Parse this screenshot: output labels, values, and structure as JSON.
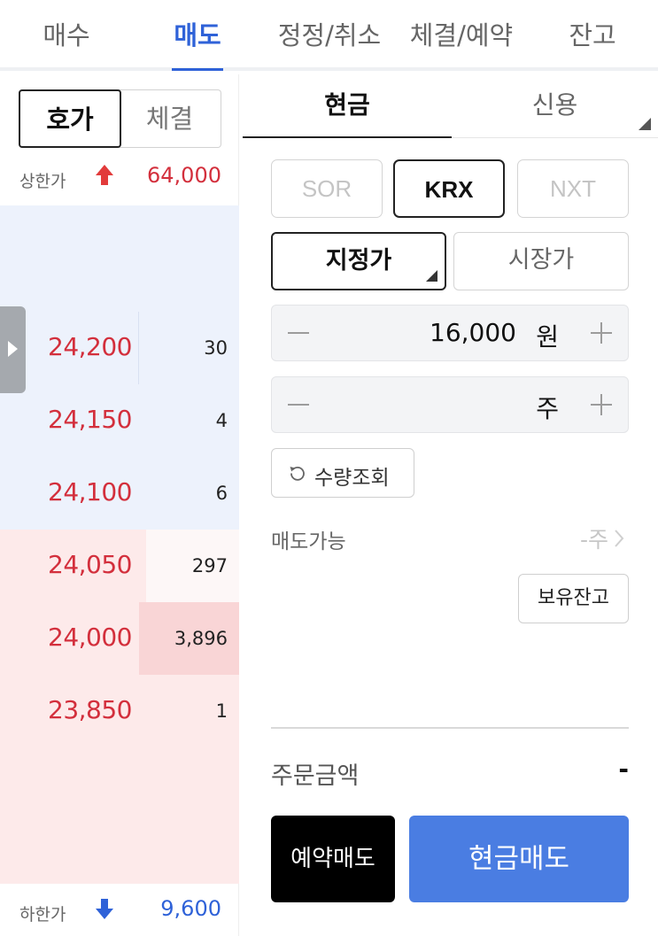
{
  "top_tabs": [
    {
      "label": "매수"
    },
    {
      "label": "매도"
    },
    {
      "label": "정정/취소"
    },
    {
      "label": "체결/예약"
    },
    {
      "label": "잔고"
    }
  ],
  "left": {
    "segment": {
      "active": "호가",
      "inactive": "체결"
    },
    "upper_limit": {
      "label": "상한가",
      "price": "64,000",
      "icon": "arrow-up-icon",
      "color": "#e23b3b"
    },
    "lower_limit": {
      "label": "하한가",
      "price": "9,600",
      "icon": "arrow-down-icon",
      "color": "#2f62d8"
    },
    "order_book": [
      {
        "price": "24,200",
        "qty": "30",
        "side": "ask"
      },
      {
        "price": "24,150",
        "qty": "4",
        "side": "ask"
      },
      {
        "price": "24,100",
        "qty": "6",
        "side": "ask"
      },
      {
        "price": "24,050",
        "qty": "297",
        "side": "bid"
      },
      {
        "price": "24,000",
        "qty": "3,896",
        "side": "bid"
      },
      {
        "price": "23,850",
        "qty": "1",
        "side": "bid"
      }
    ]
  },
  "right": {
    "sub_tabs": {
      "active": "현금",
      "inactive": "신용"
    },
    "markets": [
      {
        "label": "SOR",
        "selected": false
      },
      {
        "label": "KRX",
        "selected": true
      },
      {
        "label": "NXT",
        "selected": false
      }
    ],
    "price_types": {
      "active": "지정가",
      "inactive": "시장가"
    },
    "price_input": {
      "value": "16,000",
      "unit": "원"
    },
    "qty_input": {
      "value": "",
      "unit": "주"
    },
    "qty_check_label": "수량조회",
    "available": {
      "label": "매도가능",
      "value": "-주"
    },
    "holdings_button": "보유잔고",
    "order_amount": {
      "label": "주문금액",
      "value": "-"
    },
    "reserve_button": "예약매도",
    "sell_button": "현금매도",
    "colors": {
      "accent": "#2f62d8",
      "sell_button": "#4a7de2",
      "price_red": "#d32f3c"
    }
  }
}
